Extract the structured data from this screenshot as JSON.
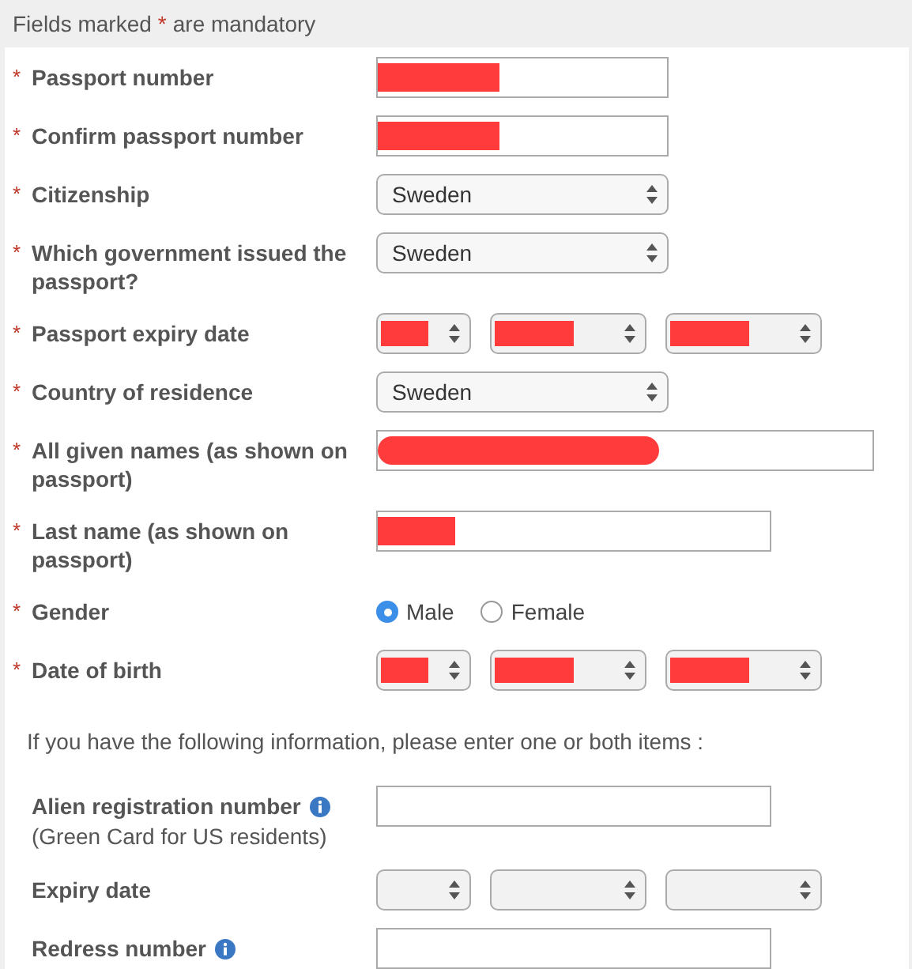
{
  "notice": {
    "before": "Fields marked",
    "mark": "*",
    "after": "are mandatory"
  },
  "rows": [
    {
      "kind": "text",
      "label": "Passport number",
      "required": true,
      "redacted": true
    },
    {
      "kind": "text",
      "label": "Confirm passport number",
      "required": true,
      "redacted": true
    },
    {
      "kind": "select",
      "label": "Citizenship",
      "required": true,
      "value": "Sweden"
    },
    {
      "kind": "select",
      "label": "Which government issued the passport?",
      "required": true,
      "value": "Sweden"
    },
    {
      "kind": "date",
      "label": "Passport expiry date",
      "required": true,
      "parts": [
        {
          "redacted": true
        },
        {
          "redacted": true
        },
        {
          "redacted": true
        }
      ]
    },
    {
      "kind": "select",
      "label": "Country of residence",
      "required": true,
      "value": "Sweden"
    },
    {
      "kind": "text",
      "label": "All given names (as shown on passport)",
      "required": true,
      "redacted": true
    },
    {
      "kind": "text",
      "label": "Last name (as shown on passport)",
      "required": true,
      "redacted": true
    },
    {
      "kind": "radio",
      "label": "Gender",
      "required": true,
      "options": [
        {
          "label": "Male",
          "selected": true
        },
        {
          "label": "Female",
          "selected": false
        }
      ]
    },
    {
      "kind": "date",
      "label": "Date of birth",
      "required": true,
      "parts": [
        {
          "redacted": true
        },
        {
          "redacted": true
        },
        {
          "redacted": true
        }
      ]
    }
  ],
  "optional_intro": "If you have the following information, please enter one or both items :",
  "optional_rows": [
    {
      "kind": "text",
      "label": "Alien registration number",
      "required": false,
      "info": true,
      "note": "(Green Card for US residents)",
      "redacted": false
    },
    {
      "kind": "date",
      "label": "Expiry date",
      "required": false,
      "parts": [
        {
          "redacted": false
        },
        {
          "redacted": false
        },
        {
          "redacted": false
        }
      ]
    },
    {
      "kind": "text",
      "label": "Redress number",
      "required": false,
      "info": true,
      "redacted": false
    }
  ]
}
